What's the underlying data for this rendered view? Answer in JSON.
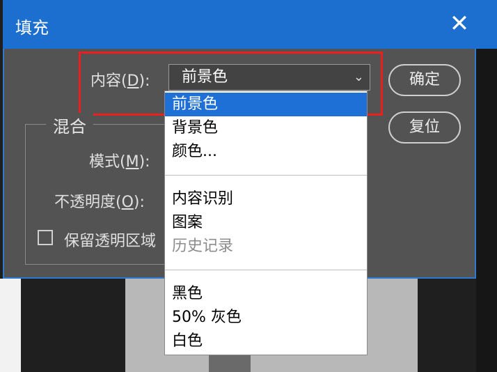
{
  "dialog": {
    "title": "填充",
    "close_glyph": "✕"
  },
  "content": {
    "label_prefix": "内容(",
    "label_key": "D",
    "label_suffix": "):",
    "selected_value": "前景色",
    "arrow_glyph": "⌄"
  },
  "buttons": {
    "ok": "确定",
    "reset": "复位"
  },
  "blend_group": {
    "title": "混合",
    "mode_prefix": "模式(",
    "mode_key": "M",
    "mode_suffix": "):",
    "opacity_prefix": "不透明度(",
    "opacity_key": "O",
    "opacity_suffix": "):",
    "preserve_label": "保留透明区域"
  },
  "dropdown": {
    "options": [
      {
        "label": "前景色",
        "state": "selected"
      },
      {
        "label": "背景色",
        "state": "normal"
      },
      {
        "label": "颜色...",
        "state": "normal"
      },
      {
        "label": "内容识别",
        "state": "normal"
      },
      {
        "label": "图案",
        "state": "normal"
      },
      {
        "label": "历史记录",
        "state": "disabled"
      },
      {
        "label": "黑色",
        "state": "normal"
      },
      {
        "label": "50% 灰色",
        "state": "normal"
      },
      {
        "label": "白色",
        "state": "normal"
      }
    ]
  },
  "colors": {
    "titlebar": "#1c6fcf",
    "highlight": "#e82020",
    "selected": "#1e6fd6"
  }
}
